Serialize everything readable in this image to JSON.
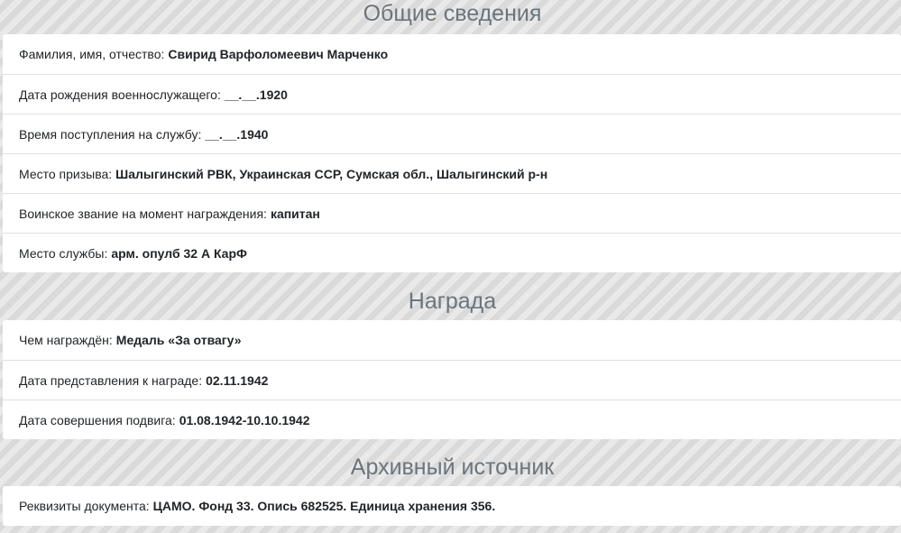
{
  "general": {
    "title": "Общие сведения",
    "rows": [
      {
        "label": "Фамилия, имя, отчество:",
        "value": "Свирид Варфоломеевич Марченко"
      },
      {
        "label": "Дата рождения военнослужащего:",
        "value": "__.__.1920"
      },
      {
        "label": "Время поступления на службу:",
        "value": "__.__.1940"
      },
      {
        "label": "Место призыва:",
        "value": "Шалыгинский РВК, Украинская ССР, Сумская обл., Шалыгинский р-н"
      },
      {
        "label": "Воинское звание на момент награждения:",
        "value": "капитан"
      },
      {
        "label": "Место службы:",
        "value": "арм. опулб 32 А КарФ"
      }
    ]
  },
  "award": {
    "title": "Награда",
    "rows": [
      {
        "label": "Чем награждён:",
        "value": "Медаль «За отвагу»"
      },
      {
        "label": "Дата представления к награде:",
        "value": "02.11.1942"
      },
      {
        "label": "Дата совершения подвига:",
        "value": "01.08.1942-10.10.1942"
      }
    ]
  },
  "archive": {
    "title": "Архивный источник",
    "rows": [
      {
        "label": "Реквизиты документа:",
        "value": "ЦАМО. Фонд 33. Опись 682525. Единица хранения 356."
      }
    ]
  }
}
